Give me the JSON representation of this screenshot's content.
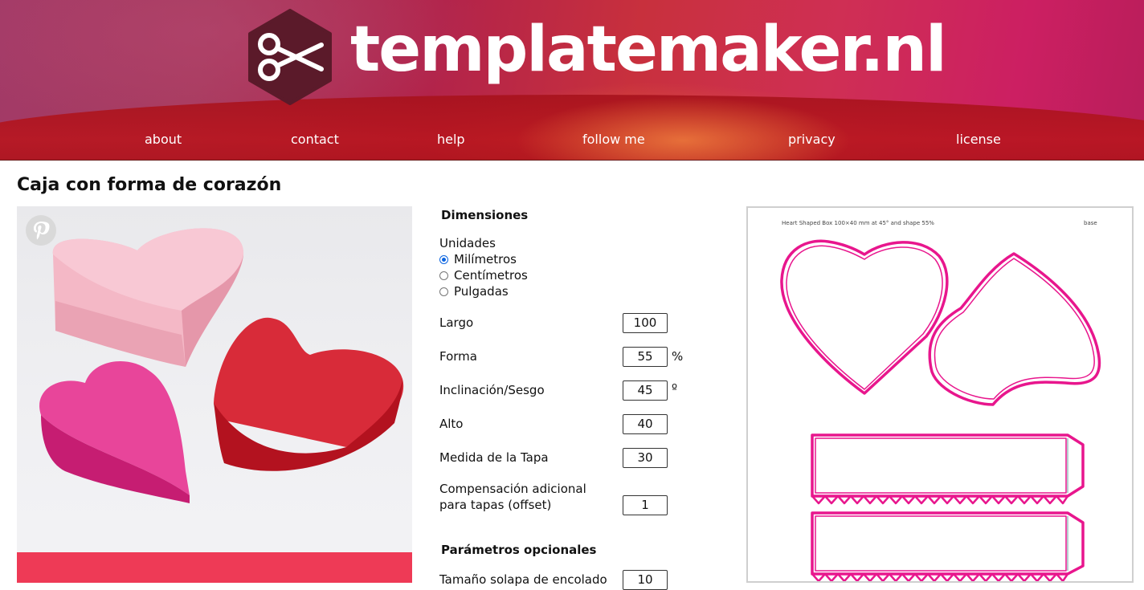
{
  "site": {
    "name": "templatemaker.nl",
    "nav": [
      "about",
      "contact",
      "help",
      "follow me",
      "privacy",
      "license"
    ]
  },
  "page": {
    "title": "Caja con forma de corazón"
  },
  "form": {
    "dimensions_title": "Dimensiones",
    "units_label": "Unidades",
    "units": [
      {
        "label": "Milímetros",
        "selected": true
      },
      {
        "label": "Centímetros",
        "selected": false
      },
      {
        "label": "Pulgadas",
        "selected": false
      }
    ],
    "fields": [
      {
        "label": "Largo",
        "value": "100",
        "unit": ""
      },
      {
        "label": "Forma",
        "value": "55",
        "unit": "%"
      },
      {
        "label": "Inclinación/Sesgo",
        "value": "45",
        "unit": "º"
      },
      {
        "label": "Alto",
        "value": "40",
        "unit": ""
      },
      {
        "label": "Medida de la Tapa",
        "value": "30",
        "unit": ""
      }
    ],
    "offset": {
      "label_line1": "Compensación adicional",
      "label_line2": "para tapas (offset)",
      "value": "1"
    },
    "optional_title": "Parámetros opcionales",
    "glue_flap": {
      "label": "Tamaño solapa de encolado",
      "value": "10"
    }
  },
  "preview": {
    "caption": "Heart Shaped Box 100×40 mm at 45° and shape 55%",
    "tag": "base"
  },
  "colors": {
    "accent": "#e8168d",
    "radio": "#0b64e0"
  },
  "icons": {
    "logo": "scissors-hexagon-icon",
    "share": "pinterest-icon"
  }
}
